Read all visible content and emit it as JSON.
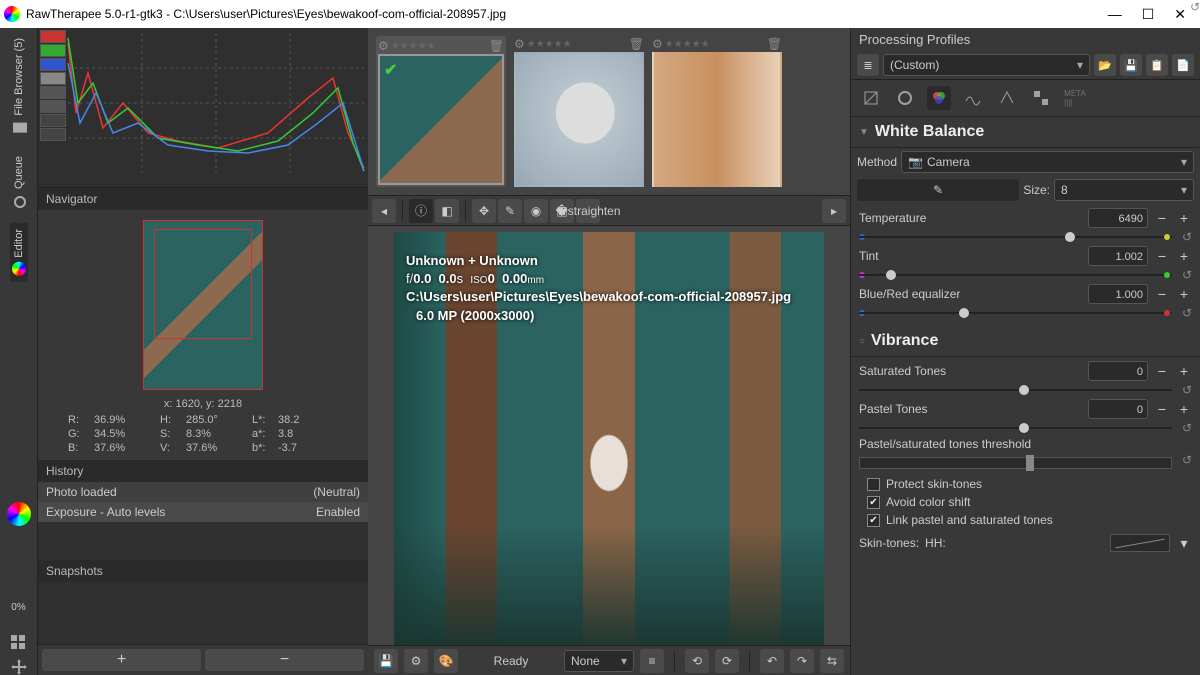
{
  "window": {
    "title": "RawTherapee 5.0-r1-gtk3 - C:\\Users\\user\\Pictures\\Eyes\\bewakoof-com-official-208957.jpg"
  },
  "left_tabs": {
    "file_browser": "File Browser (5)",
    "queue": "Queue",
    "editor": "Editor"
  },
  "navigator": {
    "title": "Navigator",
    "coords": "x: 1620, y: 2218",
    "R": "36.9%",
    "G": "34.5%",
    "B": "37.6%",
    "H": "285.0°",
    "S": "8.3%",
    "V": "37.6%",
    "Ls": "38.2",
    "as": "3.8",
    "bs": "-3.7"
  },
  "history": {
    "title": "History",
    "items": [
      {
        "l": "Photo loaded",
        "r": "(Neutral)"
      },
      {
        "l": "Exposure - Auto levels",
        "r": "Enabled"
      }
    ]
  },
  "snapshots": {
    "title": "Snapshots"
  },
  "zoom_pct": "0%",
  "overlay": {
    "line1": "Unknown + Unknown",
    "fno": "0.0",
    "shutter": "0.0",
    "iso": "0",
    "focal": "0.00",
    "path": "C:\\Users\\user\\Pictures\\Eyes\\bewakoof-com-official-208957.jpg",
    "mp": "6.0 MP (2000x3000)"
  },
  "status": {
    "ready": "Ready",
    "output": "None"
  },
  "profiles": {
    "title": "Processing Profiles",
    "value": "(Custom)"
  },
  "wb": {
    "title": "White Balance",
    "method_label": "Method",
    "method": "Camera",
    "size_label": "Size:",
    "size": "8",
    "temperature": {
      "label": "Temperature",
      "val": "6490"
    },
    "tint": {
      "label": "Tint",
      "val": "1.002"
    },
    "bre": {
      "label": "Blue/Red equalizer",
      "val": "1.000"
    }
  },
  "vibrance": {
    "title": "Vibrance",
    "sat": {
      "label": "Saturated Tones",
      "val": "0"
    },
    "pas": {
      "label": "Pastel Tones",
      "val": "0"
    },
    "thr": {
      "label": "Pastel/saturated tones threshold"
    },
    "chk1": "Protect skin-tones",
    "chk2": "Avoid color shift",
    "chk3": "Link pastel and saturated tones",
    "skin_label": "Skin-tones:",
    "skin_mode": "HH:"
  }
}
